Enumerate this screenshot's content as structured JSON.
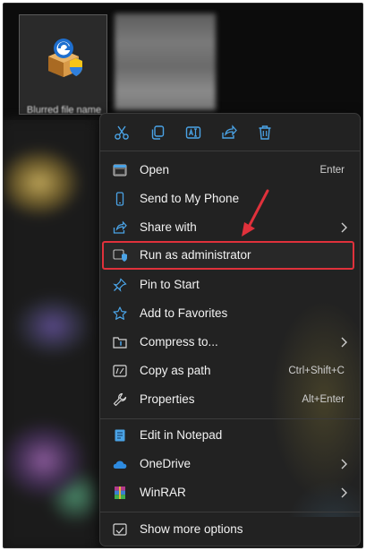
{
  "desktop": {
    "file_label": "Blurred file name"
  },
  "quick_actions": [
    {
      "name": "cut"
    },
    {
      "name": "copy"
    },
    {
      "name": "rename"
    },
    {
      "name": "share"
    },
    {
      "name": "delete"
    }
  ],
  "menu": {
    "items": [
      {
        "label": "Open",
        "shortcut": "Enter",
        "icon": "open-icon"
      },
      {
        "label": "Send to My Phone",
        "shortcut": "",
        "icon": "phone-icon"
      },
      {
        "label": "Share with",
        "shortcut": "",
        "icon": "share-icon",
        "submenu": true
      },
      {
        "label": "Run as administrator",
        "shortcut": "",
        "icon": "shield-icon",
        "highlighted": true
      },
      {
        "label": "Pin to Start",
        "shortcut": "",
        "icon": "pin-icon"
      },
      {
        "label": "Add to Favorites",
        "shortcut": "",
        "icon": "star-icon"
      },
      {
        "label": "Compress to...",
        "shortcut": "",
        "icon": "zip-icon",
        "submenu": true
      },
      {
        "label": "Copy as path",
        "shortcut": "Ctrl+Shift+C",
        "icon": "copy-path-icon"
      },
      {
        "label": "Properties",
        "shortcut": "Alt+Enter",
        "icon": "wrench-icon"
      },
      {
        "label": "Edit in Notepad",
        "shortcut": "",
        "icon": "notepad-icon"
      },
      {
        "label": "OneDrive",
        "shortcut": "",
        "icon": "cloud-icon",
        "submenu": true
      },
      {
        "label": "WinRAR",
        "shortcut": "",
        "icon": "winrar-icon",
        "submenu": true
      },
      {
        "label": "Show more options",
        "shortcut": "",
        "icon": "show-more-icon"
      }
    ]
  },
  "colors": {
    "accent_blue": "#4aa3e6",
    "highlight_red": "#e0313b",
    "menu_bg": "#222222"
  }
}
